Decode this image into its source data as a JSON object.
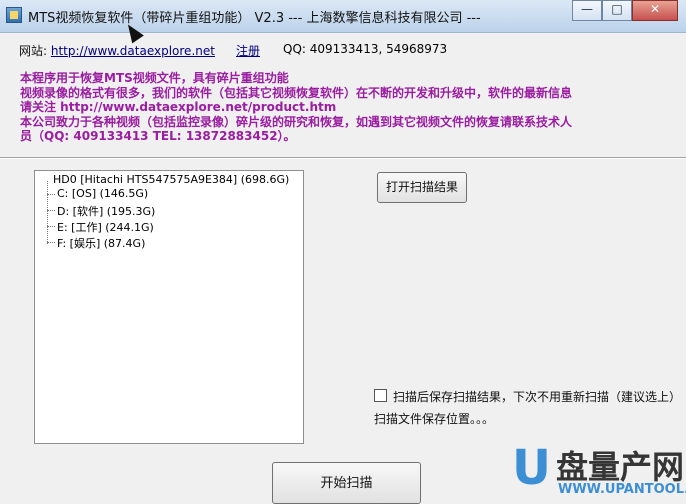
{
  "window": {
    "title": "MTS视频恢复软件（带碎片重组功能） V2.3 --- 上海数擎信息科技有限公司 ---",
    "minimize_label": "—",
    "maximize_label": "□",
    "close_label": "✕"
  },
  "header": {
    "site_label": "网站:",
    "site_url": "http://www.dataexplore.net",
    "register_label": "注册",
    "qq_text": "QQ: 409133413, 54968973"
  },
  "intro": {
    "lines": [
      "本程序用于恢复MTS视频文件，具有碎片重组功能",
      "视频录像的格式有很多，我们的软件（包括其它视频恢复软件）在不断的开发和升级中，软件的最新信息",
      "请关注 http://www.dataexplore.net/product.htm",
      "本公司致力于各种视频（包括监控录像）碎片级的研究和恢复，如遇到其它视频文件的恢复请联系技术人",
      "员（QQ: 409133413  TEL: 13872883452）。"
    ]
  },
  "drives": {
    "root": "HD0   [Hitachi HTS547575A9E384]  (698.6G)",
    "items": [
      "C:   [OS]   (146.5G)",
      "D:   [软件]   (195.3G)",
      "E:   [工作]   (244.1G)",
      "F:   [娱乐]   (87.4G)"
    ]
  },
  "buttons": {
    "open_result": "打开扫描结果",
    "start_scan": "开始扫描"
  },
  "options": {
    "save_scan_text": "扫描后保存扫描结果，下次不用重新扫描（建议选上）",
    "save_location_text": "扫描文件保存位置。。。"
  },
  "watermark": {
    "logo_text": "盘量产网",
    "logo_u": "U",
    "url_text": "WWW.UPANTOOL.COM"
  },
  "colors": {
    "intro": "#9b1da1",
    "link": "#000080",
    "logo_blue": "#3c8ed5"
  }
}
